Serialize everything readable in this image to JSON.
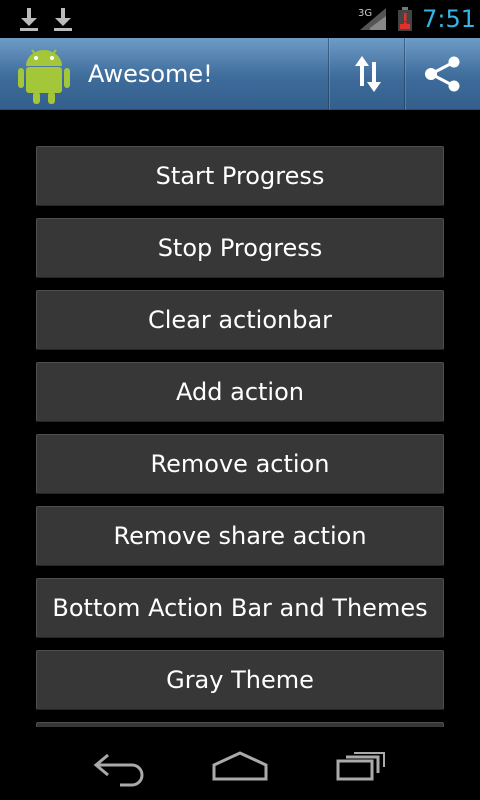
{
  "status_bar": {
    "network_type": "3G",
    "time": "7:51",
    "icons": [
      "download-icon",
      "download-icon",
      "signal-3g-icon",
      "battery-low-icon"
    ]
  },
  "action_bar": {
    "title": "Awesome!",
    "home_icon": "android-icon",
    "actions": [
      "refresh-sync-icon",
      "share-icon"
    ],
    "background_color": "#4a78a8"
  },
  "buttons": [
    "Start Progress",
    "Stop Progress",
    "Clear actionbar",
    "Add action",
    "Remove action",
    "Remove share action",
    "Bottom Action Bar and Themes",
    "Gray Theme"
  ],
  "nav_bar": {
    "icons": [
      "back-icon",
      "home-icon",
      "recent-apps-icon"
    ]
  },
  "colors": {
    "clock": "#33b5e5",
    "button_background": "#373737",
    "battery_low": "#e0312a"
  }
}
